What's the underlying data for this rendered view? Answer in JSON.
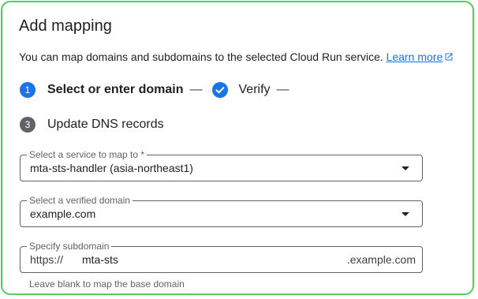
{
  "dialog": {
    "title": "Add mapping",
    "description": "You can map domains and subdomains to the selected Cloud Run service.",
    "learn_more": "Learn more"
  },
  "stepper": {
    "step1": {
      "number": "1",
      "label": "Select or enter domain"
    },
    "separator": "—",
    "step2": {
      "label": "Verify",
      "icon": "check-circle-icon"
    },
    "step3": {
      "number": "3",
      "label": "Update DNS records"
    }
  },
  "service_select": {
    "label": "Select a service to map to *",
    "value": "mta-sts-handler (asia-northeast1)"
  },
  "domain_select": {
    "label": "Select a verified domain",
    "value": "example.com"
  },
  "subdomain_field": {
    "label": "Specify subdomain",
    "prefix": "https://",
    "value": "mta-sts",
    "suffix": ".example.com",
    "hint": "Leave blank to map the base domain"
  },
  "colors": {
    "accent": "#1a73e8",
    "border_highlight": "#4fcf5f",
    "step_inactive": "#5f6368"
  }
}
